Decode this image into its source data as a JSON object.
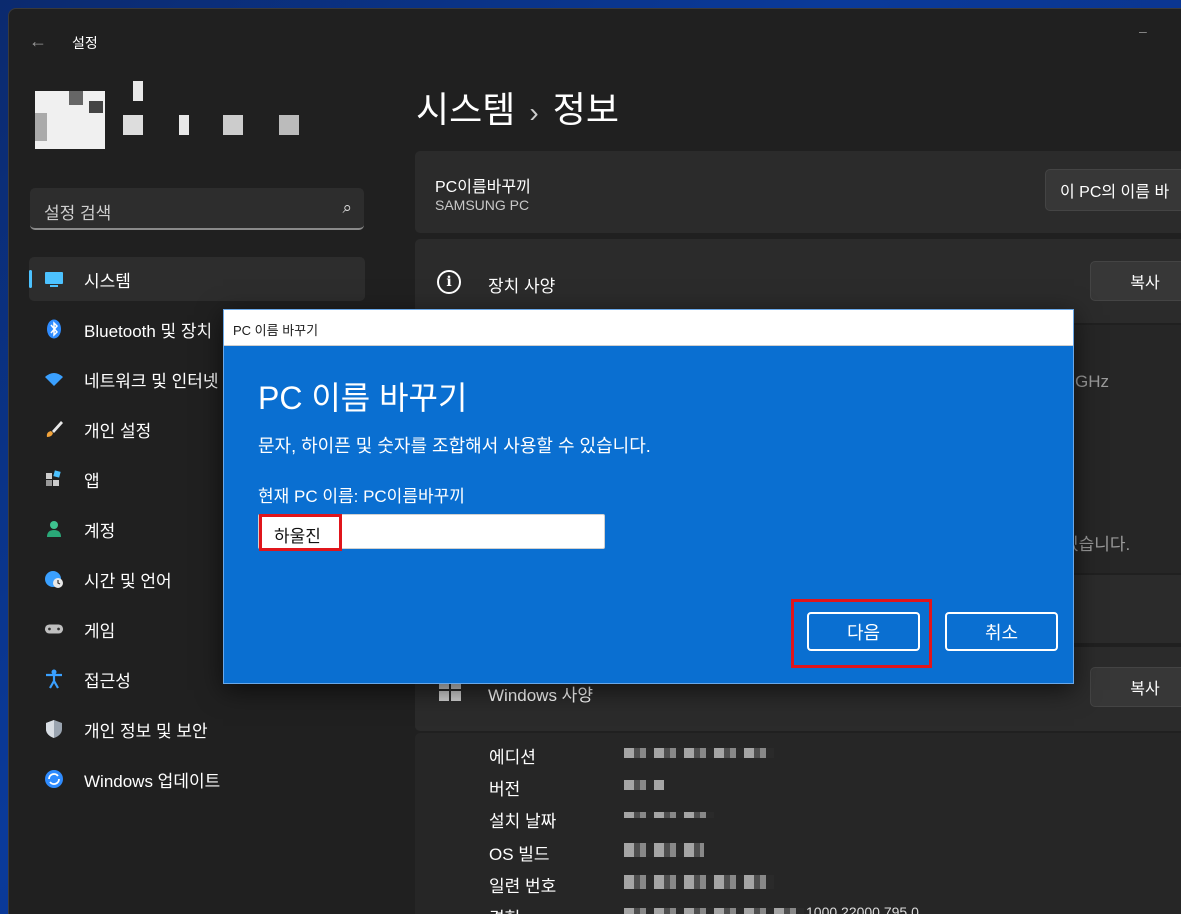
{
  "window": {
    "app_title": "설정",
    "back_glyph": "←",
    "minimize_glyph": "–"
  },
  "search": {
    "placeholder": "설정 검색",
    "icon": "⌕"
  },
  "sidebar": {
    "items": [
      {
        "label": "시스템",
        "icon": "monitor-icon",
        "active": true
      },
      {
        "label": "Bluetooth 및 장치",
        "icon": "bluetooth-icon"
      },
      {
        "label": "네트워크 및 인터넷",
        "icon": "wifi-icon"
      },
      {
        "label": "개인 설정",
        "icon": "brush-icon"
      },
      {
        "label": "앱",
        "icon": "apps-icon"
      },
      {
        "label": "계정",
        "icon": "person-icon"
      },
      {
        "label": "시간 및 언어",
        "icon": "globe-clock-icon"
      },
      {
        "label": "게임",
        "icon": "gamepad-icon"
      },
      {
        "label": "접근성",
        "icon": "accessibility-icon"
      },
      {
        "label": "개인 정보 및 보안",
        "icon": "shield-icon"
      },
      {
        "label": "Windows 업데이트",
        "icon": "update-icon"
      }
    ]
  },
  "main": {
    "breadcrumb_parent": "시스템",
    "breadcrumb_sep": "›",
    "breadcrumb_current": "정보",
    "rename_card": {
      "title": "PC이름바꾸끼",
      "subtitle": "SAMSUNG PC",
      "button": "이 PC의 이름 바"
    },
    "device_specs": {
      "title": "장치 사양",
      "copy_button": "복사",
      "partial_ghz": "GHz",
      "partial_text": "있습니다."
    },
    "windows_specs": {
      "title": "Windows 사양",
      "copy_button": "복사",
      "labels": [
        "에디션",
        "버전",
        "설치 날짜",
        "OS 빌드",
        "일련 번호",
        "경험"
      ],
      "partial_experience": "1000.22000.795.0"
    }
  },
  "dialog": {
    "title_bar": "PC 이름 바꾸기",
    "heading": "PC 이름 바꾸기",
    "description": "문자, 하이픈 및 숫자를 조합해서 사용할 수 있습니다.",
    "current_name": "현재 PC 이름: PC이름바꾸끼",
    "input_value": "하울진",
    "next_button": "다음",
    "cancel_button": "취소"
  },
  "colors": {
    "dialog_bg": "#0a6fd1",
    "highlight_red": "#e0151b",
    "accent": "#4cc2ff",
    "window_bg": "#202020"
  }
}
